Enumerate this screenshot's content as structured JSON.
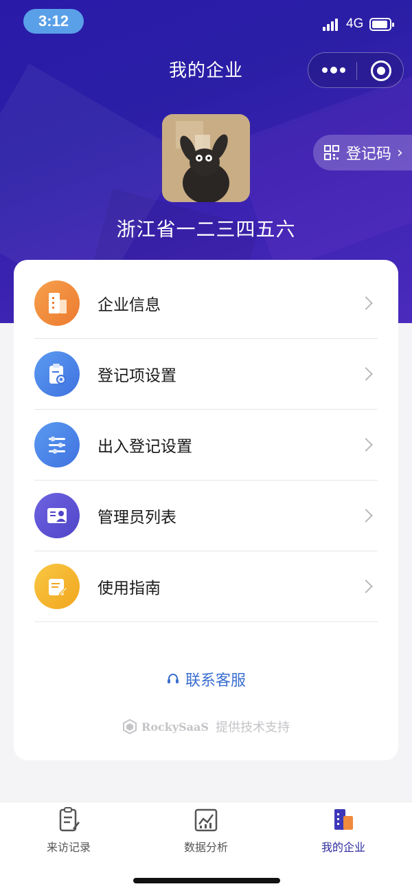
{
  "status_bar": {
    "time": "3:12",
    "network": "4G",
    "battery_level": 0.85
  },
  "nav": {
    "title": "我的企业",
    "more_icon": "more-dots-icon",
    "close_icon": "target-icon"
  },
  "profile": {
    "company_name": "浙江省一二三四五六",
    "register_code_label": "登记码",
    "register_code_icon": "qr-code-icon"
  },
  "menu": {
    "items": [
      {
        "label": "企业信息",
        "icon": "building-icon",
        "color": "#f0893a"
      },
      {
        "label": "登记项设置",
        "icon": "clipboard-settings-icon",
        "color": "#4a86ea"
      },
      {
        "label": "出入登记设置",
        "icon": "sliders-icon",
        "color": "#4a86ea"
      },
      {
        "label": "管理员列表",
        "icon": "admin-card-icon",
        "color": "#5b52d6"
      },
      {
        "label": "使用指南",
        "icon": "guide-notepad-icon",
        "color": "#f4b52c"
      }
    ]
  },
  "footer": {
    "contact_label": "联系客服",
    "brand": "RockySaaS",
    "powered_text": "提供技术支持"
  },
  "tabbar": {
    "tabs": [
      {
        "label": "来访记录",
        "icon": "visit-record-icon",
        "active": false
      },
      {
        "label": "数据分析",
        "icon": "data-analysis-icon",
        "active": false
      },
      {
        "label": "我的企业",
        "icon": "my-company-icon",
        "active": true
      }
    ],
    "active_color": "#2d2a9e"
  }
}
